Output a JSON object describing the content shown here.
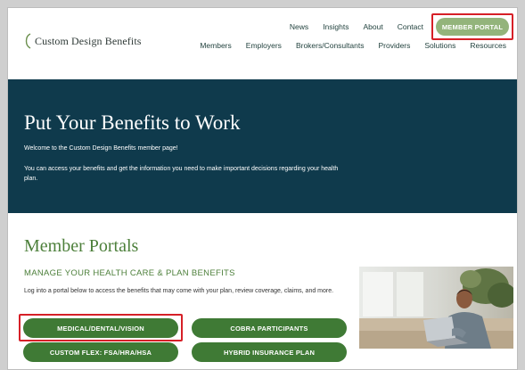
{
  "header": {
    "logo_text": "Custom Design Benefits",
    "top_nav": [
      "News",
      "Insights",
      "About",
      "Contact"
    ],
    "portal_button": "MEMBER PORTAL",
    "main_nav": [
      "Members",
      "Employers",
      "Brokers/Consultants",
      "Providers",
      "Solutions",
      "Resources"
    ]
  },
  "hero": {
    "title": "Put Your Benefits to Work",
    "subtitle": "Welcome to the Custom Design Benefits member page!",
    "description": "You can access your benefits and get the information you need to make important decisions regarding your health plan."
  },
  "portals": {
    "title": "Member Portals",
    "subtitle": "MANAGE YOUR HEALTH CARE & PLAN BENEFITS",
    "description": "Log into a portal below to access the benefits that may come with your plan, review coverage, claims, and more.",
    "buttons": {
      "medical": "MEDICAL/DENTAL/VISION",
      "cobra": "COBRA PARTICIPANTS",
      "flex": "CUSTOM FLEX: FSA/HRA/HSA",
      "hybrid": "HYBRID INSURANCE PLAN"
    }
  },
  "colors": {
    "hero_bg": "#0f3a4c",
    "button_green": "#3f7a35",
    "portal_green": "#93b47b",
    "heading_green": "#4c7f3a",
    "highlight_red": "#d62027"
  },
  "images": {
    "hero_photo": "man-with-laptop-on-couch"
  }
}
